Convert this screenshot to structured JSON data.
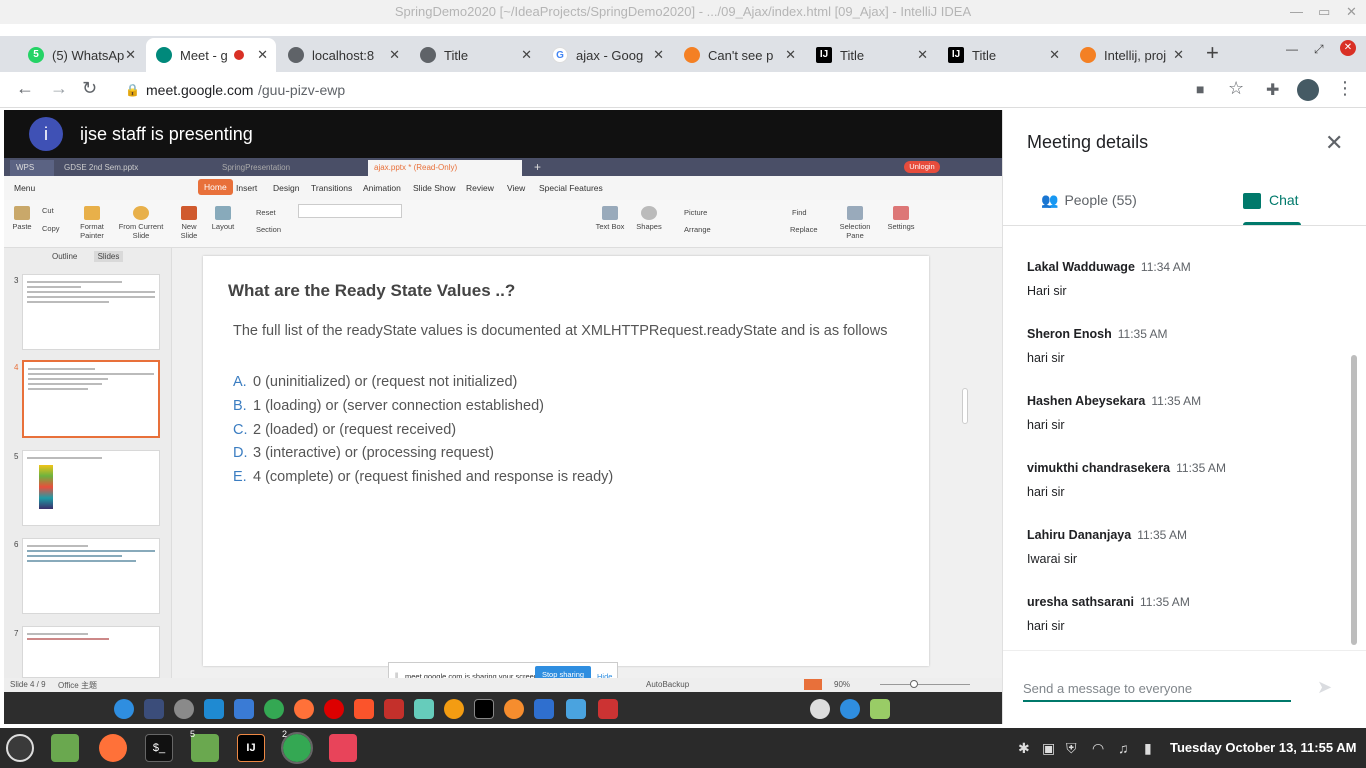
{
  "window_title": "SpringDemo2020 [~/IdeaProjects/SpringDemo2020] - .../09_Ajax/index.html [09_Ajax] - IntelliJ IDEA",
  "tabs": [
    {
      "label": "(5) WhatsAp",
      "icon": "whatsapp-icon",
      "badge": "5"
    },
    {
      "label": "Meet - g",
      "icon": "meet-icon",
      "active": true
    },
    {
      "label": "localhost:8",
      "icon": "globe-icon"
    },
    {
      "label": "Title",
      "icon": "globe-icon"
    },
    {
      "label": "ajax - Goog",
      "icon": "google-icon"
    },
    {
      "label": "Can't see p",
      "icon": "stackoverflow-icon"
    },
    {
      "label": "Title",
      "icon": "intellij-icon"
    },
    {
      "label": "Title",
      "icon": "intellij-icon"
    },
    {
      "label": "Intellij, proj",
      "icon": "stackoverflow-icon"
    }
  ],
  "new_tab": "+",
  "url": {
    "host": "meet.google.com",
    "path": "/guu-pizv-ewp"
  },
  "presenter": {
    "avatar_letter": "i",
    "text": "ijse staff is presenting"
  },
  "wps": {
    "tabs": [
      "WPS",
      "GDSE 2nd Sem.pptx",
      "SpringPresentation",
      "ajax.pptx * (Read-Only)"
    ],
    "unlogin": "Unlogin",
    "menu": [
      "Menu",
      "Home",
      "Insert",
      "Design",
      "Transitions",
      "Animation",
      "Slide Show",
      "Review",
      "View",
      "Special Features"
    ],
    "ribbon": [
      "Paste",
      "Cut",
      "Copy",
      "Format Painter",
      "From Current Slide",
      "New Slide",
      "Layout",
      "Reset",
      "Section",
      "Text Box",
      "Shapes",
      "Picture",
      "Arrange",
      "Find",
      "Replace",
      "Selection Pane",
      "Settings"
    ],
    "outline": "Outline",
    "slides": "Slides",
    "status": {
      "slide": "Slide 4 / 9",
      "theme": "Office 主题",
      "autobackup": "AutoBackup",
      "zoom": "90%"
    }
  },
  "slide": {
    "title": "What are the Ready State Values ..?",
    "intro": "The full list of the readyState values is documented at XMLHTTPRequest.readyState and is as follows",
    "items": [
      {
        "letter": "A.",
        "text": "0 (uninitialized) or (request not initialized)"
      },
      {
        "letter": "B.",
        "text": "1 (loading) or (server connection established)"
      },
      {
        "letter": "C.",
        "text": "2 (loaded) or (request received)"
      },
      {
        "letter": "D.",
        "text": "3 (interactive) or (processing request)"
      },
      {
        "letter": "E.",
        "text": "4 (complete) or (request finished and response is ready)"
      }
    ]
  },
  "thumbs": {
    "numbers": [
      "3",
      "4",
      "5",
      "6",
      "7"
    ]
  },
  "share_bar": {
    "text": "meet.google.com is sharing your screen.",
    "stop": "Stop sharing",
    "hide": "Hide"
  },
  "panel": {
    "title": "Meeting details",
    "people_tab": "People (55)",
    "chat_tab": "Chat",
    "messages": [
      {
        "name": "Lakal Wadduwage",
        "time": "11:34 AM",
        "text": "Hari sir"
      },
      {
        "name": "Sheron Enosh",
        "time": "11:35 AM",
        "text": "hari sir"
      },
      {
        "name": "Hashen Abeysekara",
        "time": "11:35 AM",
        "text": "hari sir"
      },
      {
        "name": "vimukthi chandrasekera",
        "time": "11:35 AM",
        "text": "hari sir"
      },
      {
        "name": "Lahiru Dananjaya",
        "time": "11:35 AM",
        "text": "Iwarai sir"
      },
      {
        "name": "uresha sathsarani",
        "time": "11:35 AM",
        "text": "hari sir"
      }
    ],
    "input_placeholder": "Send a message to everyone"
  },
  "taskbar": {
    "clock": "Tuesday October 13, 11:55 AM",
    "badges": [
      "5",
      "2"
    ]
  },
  "colors": {
    "accent": "#00796b",
    "wps_orange": "#e8703a",
    "slide_blue": "#3b7dc1"
  }
}
